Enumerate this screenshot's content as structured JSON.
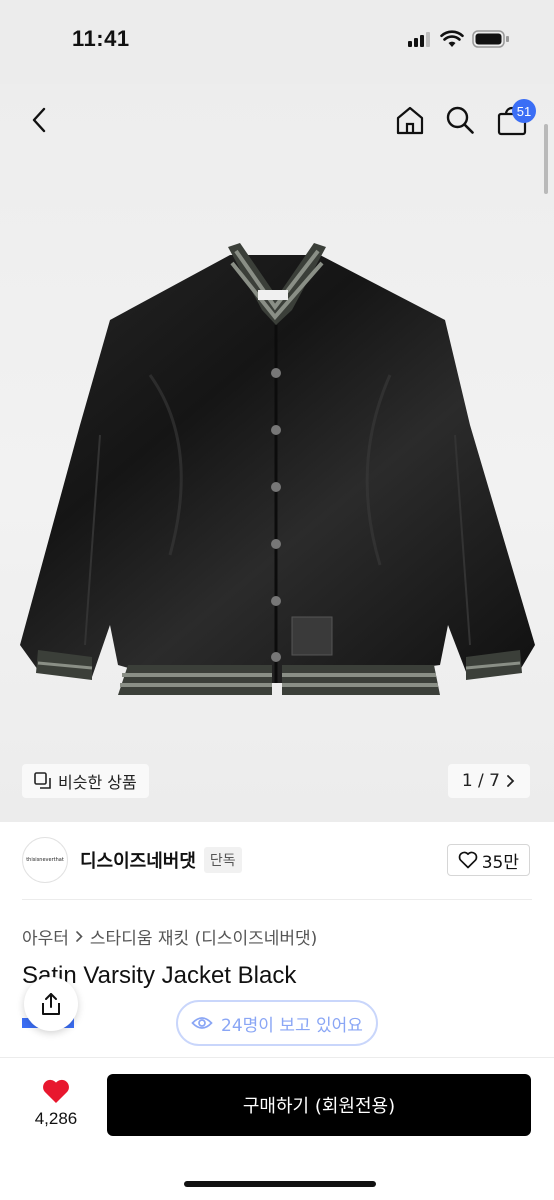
{
  "status_bar": {
    "time": "11:41"
  },
  "nav": {
    "cart_count": "51"
  },
  "gallery": {
    "similar_label": "비슷한 상품",
    "pager": "1 / 7"
  },
  "brand": {
    "logo_text": "thisisneverthat",
    "name": "디스이즈네버댓",
    "tag": "단독",
    "like_count": "35만"
  },
  "breadcrumb": {
    "category": "아우터",
    "subcategory": "스타디움 재킷 (디스이즈네버댓)"
  },
  "product": {
    "title": "Satin Varsity Jacket Black"
  },
  "viewers": {
    "label": "24명이 보고 있어요"
  },
  "bottom_bar": {
    "favorite_count": "4,286",
    "buy_label": "구매하기 (회원전용)"
  },
  "colors": {
    "accent_blue": "#3b6ef5",
    "favorite_red": "#e8172e",
    "buy_button": "#000000"
  },
  "icons": [
    "back-arrow-icon",
    "home-icon",
    "search-icon",
    "bag-icon",
    "similar-icon",
    "chevron-right-icon",
    "heart-outline-icon",
    "share-icon",
    "eye-icon",
    "heart-filled-icon"
  ]
}
